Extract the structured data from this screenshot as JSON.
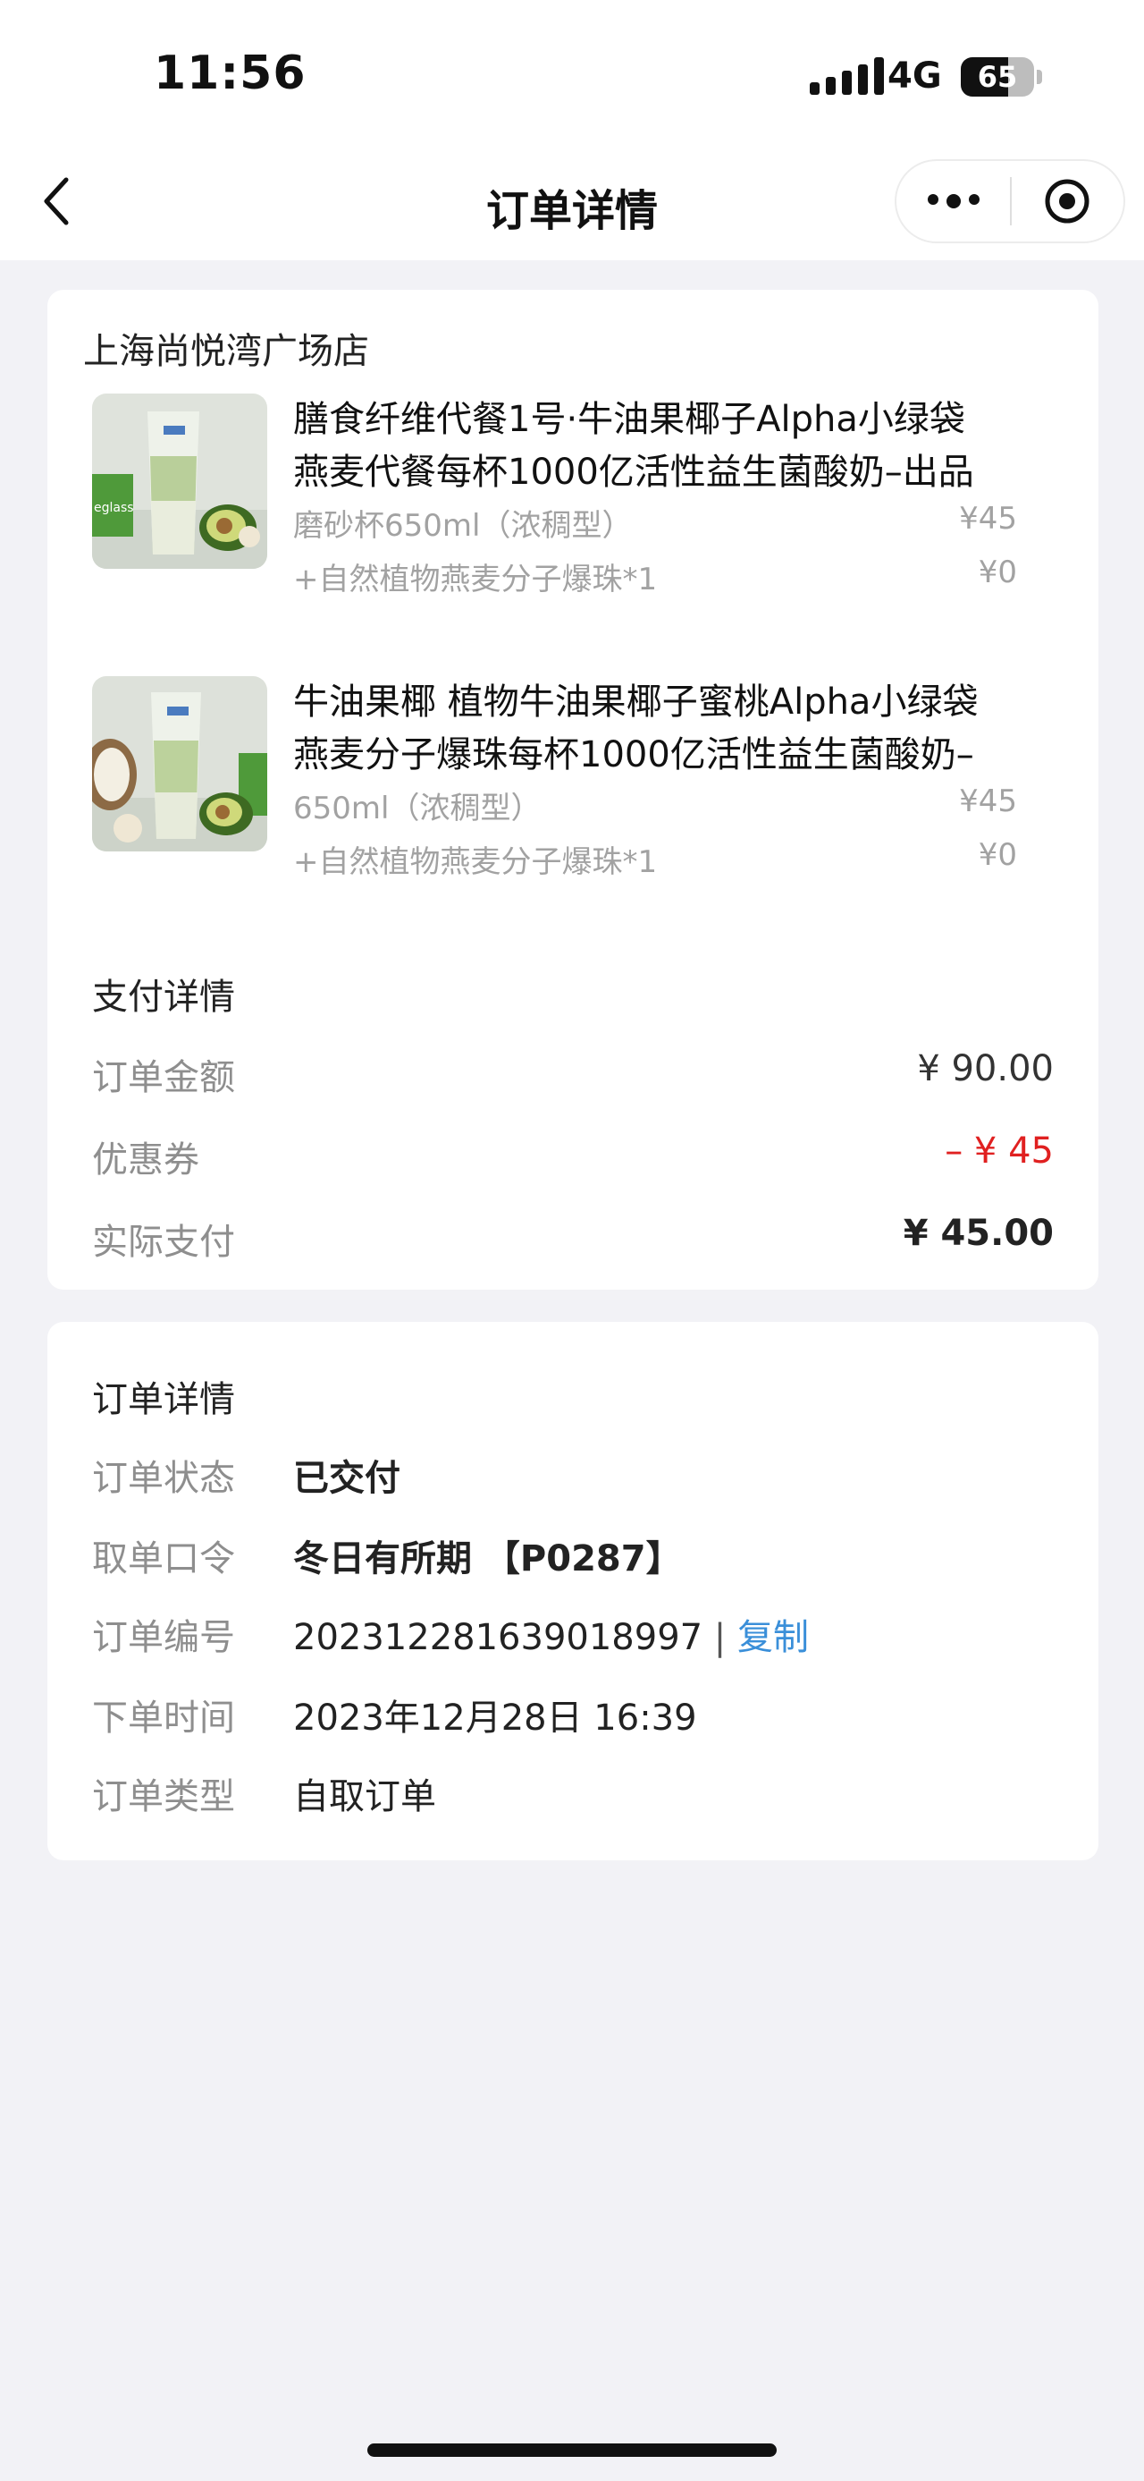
{
  "status_bar": {
    "time": "11:56",
    "network": "4G",
    "battery_percent": 65,
    "battery_label": "65"
  },
  "nav": {
    "title": "订单详情"
  },
  "store": {
    "name": "上海尚悦湾广场店"
  },
  "items": [
    {
      "name_line1": "膳食纤维代餐1号·牛油果椰子Alpha小绿袋",
      "name_line2": "燕麦代餐每杯1000亿活性益生菌酸奶–出品",
      "spec": "磨砂杯650ml（浓稠型）",
      "spec_price": "¥45",
      "addon": "+自然植物燕麦分子爆珠*1",
      "addon_price": "¥0",
      "thumb_label": "eglass"
    },
    {
      "name_line1": "牛油果椰 植物牛油果椰子蜜桃Alpha小绿袋",
      "name_line2": "燕麦分子爆珠每杯1000亿活性益生菌酸奶–",
      "spec": "650ml（浓稠型）",
      "spec_price": "¥45",
      "addon": "+自然植物燕麦分子爆珠*1",
      "addon_price": "¥0"
    }
  ],
  "payment": {
    "title": "支付详情",
    "rows": [
      {
        "label": "订单金额",
        "value": "¥ 90.00"
      },
      {
        "label": "优惠券",
        "value": "– ¥ 45"
      },
      {
        "label": "实际支付",
        "value": "¥ 45.00"
      }
    ]
  },
  "order": {
    "title": "订单详情",
    "rows": [
      {
        "label": "订单状态",
        "value": "已交付"
      },
      {
        "label": "取单口令",
        "value": "冬日有所期 【P0287】"
      },
      {
        "label": "订单编号",
        "value": "202312281639018997",
        "separator": " | ",
        "action": "复制"
      },
      {
        "label": "下单时间",
        "value": "2023年12月28日 16:39"
      },
      {
        "label": "订单类型",
        "value": "自取订单"
      }
    ]
  },
  "colors": {
    "accent_link": "#3a8fd9",
    "discount_red": "#e02020",
    "page_bg": "#f2f2f6",
    "avocado_green": "#6b8f2f"
  }
}
